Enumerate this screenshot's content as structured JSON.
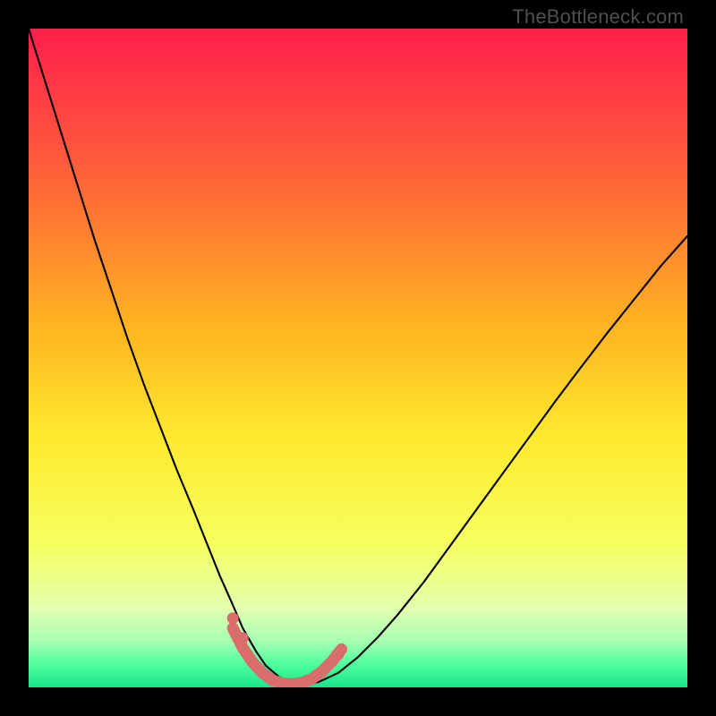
{
  "watermark": "TheBottleneck.com",
  "chart_data": {
    "type": "line",
    "title": "",
    "xlabel": "",
    "ylabel": "",
    "xlim": [
      0,
      100
    ],
    "ylim": [
      0,
      100
    ],
    "gradient_stops": [
      {
        "offset": 0,
        "color": "#ff1f4b"
      },
      {
        "offset": 0.2,
        "color": "#ff5a3c"
      },
      {
        "offset": 0.45,
        "color": "#ffb321"
      },
      {
        "offset": 0.62,
        "color": "#ffe92f"
      },
      {
        "offset": 0.78,
        "color": "#f6ff5e"
      },
      {
        "offset": 0.88,
        "color": "#e3ffb0"
      },
      {
        "offset": 0.93,
        "color": "#a5ffb3"
      },
      {
        "offset": 0.965,
        "color": "#4fff9c"
      },
      {
        "offset": 1.0,
        "color": "#17e68c"
      }
    ],
    "series": [
      {
        "name": "bottleneck-curve",
        "color": "#000000",
        "width": 2.1,
        "x": [
          0.0,
          2.5,
          5.0,
          7.5,
          10.0,
          12.5,
          15.0,
          17.5,
          20.0,
          22.5,
          25.0,
          27.0,
          29.0,
          31.0,
          32.5,
          34.5,
          36.0,
          38.0,
          40.0,
          42.0,
          44.0,
          47.0,
          50.0,
          53.0,
          56.0,
          60.0,
          64.0,
          68.0,
          72.0,
          76.0,
          80.0,
          84.0,
          88.0,
          92.0,
          96.0,
          100.0
        ],
        "values": [
          100,
          92.0,
          84.0,
          76.0,
          68.0,
          60.5,
          53.0,
          46.0,
          39.5,
          33.0,
          27.0,
          22.0,
          17.0,
          12.5,
          9.0,
          5.5,
          3.3,
          1.6,
          0.6,
          0.5,
          0.8,
          2.2,
          4.6,
          7.6,
          11.0,
          16.0,
          21.5,
          27.0,
          32.5,
          38.0,
          43.5,
          48.8,
          54.0,
          59.0,
          64.0,
          68.5
        ]
      },
      {
        "name": "marker-band",
        "color": "#d96c6c",
        "type": "band",
        "x": [
          31.0,
          32.5,
          34.0,
          35.5,
          37.0,
          38.5,
          40.0,
          41.5,
          43.0,
          44.5,
          46.0,
          47.5
        ],
        "values": [
          9.0,
          6.0,
          3.8,
          2.2,
          1.1,
          0.6,
          0.5,
          0.7,
          1.3,
          2.4,
          3.9,
          5.8
        ],
        "width": 13
      },
      {
        "name": "marker-dots",
        "color": "#d96c6c",
        "type": "scatter",
        "x": [
          31.0,
          32.5,
          47.0
        ],
        "values": [
          10.5,
          7.5,
          5.0
        ],
        "radius": 6.5
      }
    ]
  }
}
